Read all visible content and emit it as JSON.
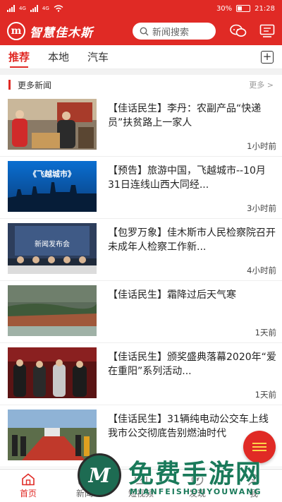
{
  "status_bar": {
    "network_left": "4G",
    "network_right": "4G",
    "battery": "30%",
    "time": "21:28"
  },
  "header": {
    "logo_mark": "m",
    "app_name": "智慧佳木斯",
    "search_placeholder": "新闻搜索",
    "icons": [
      "search-icon",
      "chat-icon",
      "tv-icon"
    ]
  },
  "tabs": [
    {
      "label": "推荐",
      "active": true
    },
    {
      "label": "本地",
      "active": false
    },
    {
      "label": "汽车",
      "active": false
    }
  ],
  "section": {
    "title": "更多新闻",
    "more": "更多 >"
  },
  "news": [
    {
      "headline": "【佳话民生】李丹：农副产品“快递员”扶贫路上一家人",
      "time": "1小时前"
    },
    {
      "headline": "【预告】旅游中国，飞越城市--10月31日连线山西大同经...",
      "time": "3小时前",
      "thumb_text": "《飞越城市》"
    },
    {
      "headline": "【包罗万象】佳木斯市人民检察院召开未成年人检察工作新...",
      "time": "4小时前",
      "thumb_text": "新闻发布会"
    },
    {
      "headline": "【佳话民生】霜降过后天气寒",
      "time": "1天前"
    },
    {
      "headline": "【佳话民生】颁奖盛典落幕2020年“爱在重阳”系列活动...",
      "time": "1天前"
    },
    {
      "headline": "【佳话民生】31辆纯电动公交车上线 我市公交彻底告别燃油时代",
      "time": ""
    }
  ],
  "bottom_tabs": [
    {
      "label": "首页",
      "active": true
    },
    {
      "label": "新闻",
      "active": false
    },
    {
      "label": "短视频",
      "active": false
    },
    {
      "label": "发现",
      "active": false
    },
    {
      "label": "我",
      "active": false
    }
  ],
  "watermark": {
    "mark": "M",
    "title": "免费手游网",
    "subtitle": "MIANFEISHOUYOUWANG"
  },
  "colors": {
    "brand_red": "#e02a25",
    "fab_stripes": "#ffd34a",
    "watermark_green": "#1a7a5a"
  }
}
